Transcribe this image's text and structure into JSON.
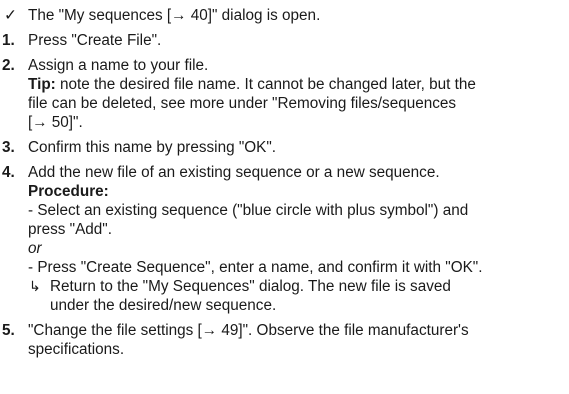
{
  "prerequisite": {
    "marker": "✓",
    "text": "The \"My sequences [→ 40]\" dialog is open."
  },
  "steps": [
    {
      "number": "1.",
      "text": "Press \"Create File\"."
    },
    {
      "number": "2.",
      "text": "Assign a name to your file.",
      "tip_label": "Tip:",
      "tip_line1": " note the desired file name. It cannot be changed later, but the",
      "tip_line2": "file can be deleted, see more under \"Removing files/sequences",
      "tip_line3": "[→ 50]\"."
    },
    {
      "number": "3.",
      "text": "Confirm this name by pressing \"OK\"."
    },
    {
      "number": "4.",
      "text": "Add the new file of an existing sequence or a new sequence.",
      "procedure_label": "Procedure:",
      "option1_line1": "- Select an existing sequence (\"blue circle with plus symbol\") and",
      "option1_line2": "press \"Add\".",
      "or_text": "or",
      "option2": "- Press \"Create Sequence\", enter a name, and confirm it with \"OK\".",
      "result_marker": "↳",
      "result_line1": "Return to the \"My Sequences\" dialog. The new file is saved",
      "result_line2": "under the desired/new sequence."
    },
    {
      "number": "5.",
      "text_line1": "\"Change the file settings [→ 49]\". Observe the file manufacturer's",
      "text_line2": "specifications."
    }
  ]
}
